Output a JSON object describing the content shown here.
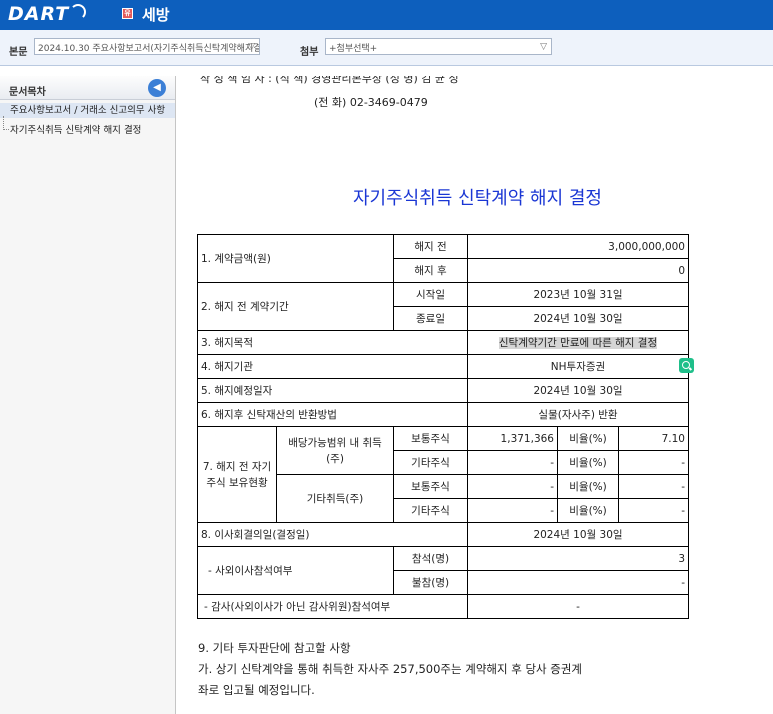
{
  "app": {
    "logo_text": "DART",
    "company_badge": "유",
    "company_name": "세방"
  },
  "toolbar": {
    "main_label": "본문",
    "main_select": "2024.10.30  주요사항보고서(자기주식취득신탁계약해지결정)",
    "attach_label": "첨부",
    "attach_select": "+첨부선택+"
  },
  "sidebar": {
    "title": "문서목차",
    "items": [
      {
        "label": "주요사항보고서 / 거래소 신고의무 사항"
      },
      {
        "label": "자기주식취득 신탁계약 해지 결정"
      }
    ]
  },
  "header": {
    "line1": "작 성 책 임 자 :       (직  책) 경영관리본부장      (성  명) 김 균 성",
    "line2": "(전  화) 02-3469-0479"
  },
  "doc_title": "자기주식취득 신탁계약 해지 결정",
  "table": {
    "r1_label": "1. 계약금액(원)",
    "r1_before_label": "해지 전",
    "r1_before_value": "3,000,000,000",
    "r1_after_label": "해지 후",
    "r1_after_value": "0",
    "r2_label": "2. 해지 전 계약기간",
    "r2_start_label": "시작일",
    "r2_start_value": "2023년 10월 31일",
    "r2_end_label": "종료일",
    "r2_end_value": "2024년 10월 30일",
    "r3_label": "3. 해지목적",
    "r3_value": "신탁계약기간 만료에 따른 해지 결정",
    "r4_label": "4. 해지기관",
    "r4_value": "NH투자증권",
    "r5_label": "5. 해지예정일자",
    "r5_value": "2024년 10월 30일",
    "r6_label": "6. 해지후 신탁재산의 반환방법",
    "r6_value": "실물(자사주) 반환",
    "r7_label": "7. 해지 전 자기주식 보유현황",
    "r7_div_label": "배당가능범위 내 취득(주)",
    "r7_other_label": "기타취득(주)",
    "common": "보통주식",
    "other_stock": "기타주식",
    "ratio": "비율(%)",
    "r7_div_common_value": "1,371,366",
    "r7_div_common_ratio": "7.10",
    "dash": "-",
    "r8_label": "8. 이사회결의일(결정일)",
    "r8_value": "2024년 10월 30일",
    "r8_outside_label": "- 사외이사참석여부",
    "r8_present_label": "참석(명)",
    "r8_present_value": "3",
    "r8_absent_label": "불참(명)",
    "r8_absent_value": "-",
    "r8_audit_label": "- 감사(사외이사가 아닌 감사위원)참석여부",
    "r8_audit_value": "-"
  },
  "notes": {
    "line1": "9. 기타 투자판단에 참고할 사항",
    "line2": "가. 상기 신탁계약을 통해 취득한 자사주 257,500주는 계약해지 후  당사 증권계",
    "line3": "좌로 입고될 예정입니다."
  }
}
